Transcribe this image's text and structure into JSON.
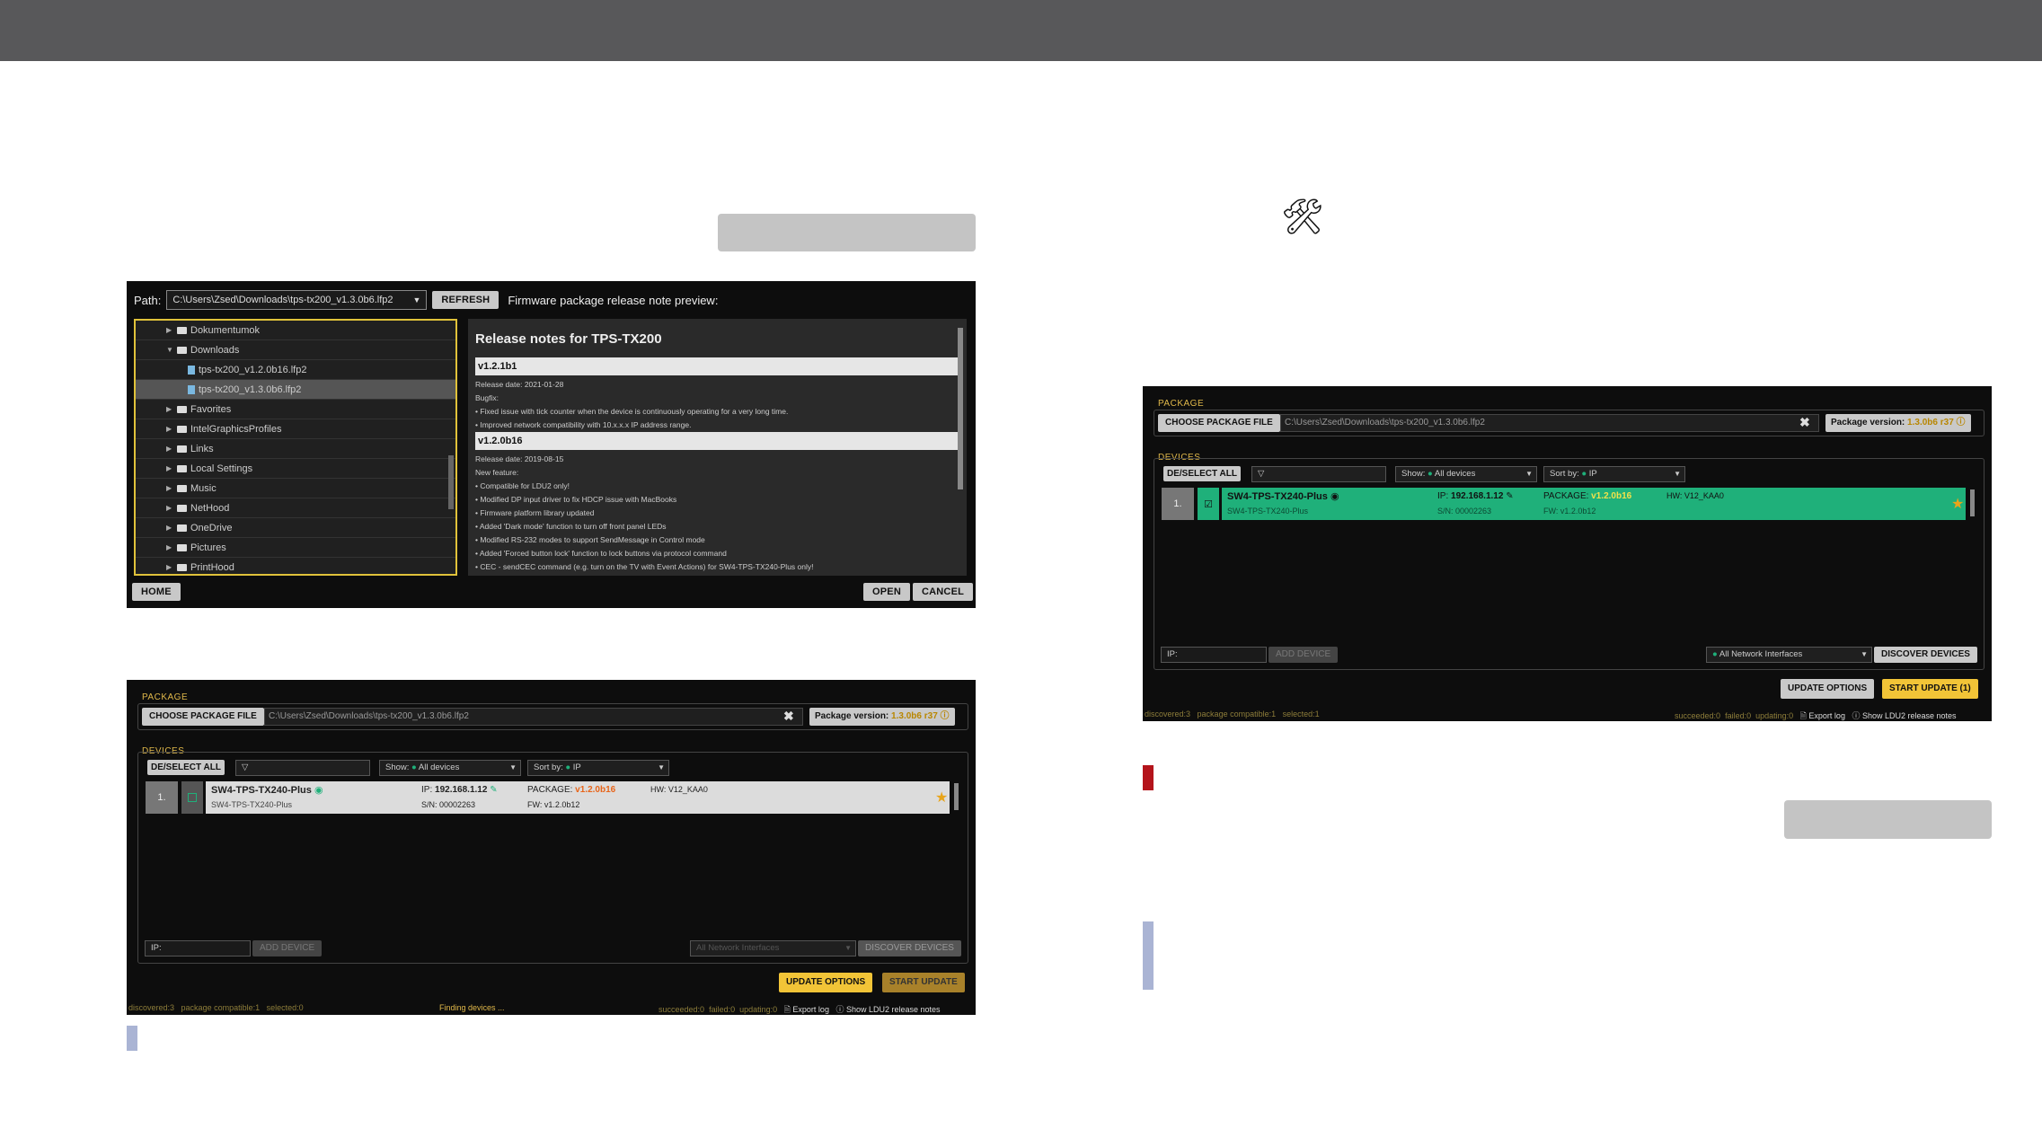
{
  "file_dialog": {
    "path_label": "Path:",
    "path_value": "C:\\Users\\Zsed\\Downloads\\tps-tx200_v1.3.0b6.lfp2",
    "refresh": "REFRESH",
    "preview_label": "Firmware package release note preview:",
    "tree": [
      {
        "label": "Dokumentumok",
        "kind": "folder",
        "indent": 1,
        "expanded": false
      },
      {
        "label": "Downloads",
        "kind": "folder",
        "indent": 1,
        "expanded": true
      },
      {
        "label": "tps-tx200_v1.2.0b16.lfp2",
        "kind": "file",
        "indent": 2
      },
      {
        "label": "tps-tx200_v1.3.0b6.lfp2",
        "kind": "file",
        "indent": 2,
        "selected": true
      },
      {
        "label": "Favorites",
        "kind": "folder",
        "indent": 1
      },
      {
        "label": "IntelGraphicsProfiles",
        "kind": "folder",
        "indent": 1
      },
      {
        "label": "Links",
        "kind": "folder",
        "indent": 1
      },
      {
        "label": "Local Settings",
        "kind": "folder",
        "indent": 1
      },
      {
        "label": "Music",
        "kind": "folder",
        "indent": 1
      },
      {
        "label": "NetHood",
        "kind": "folder",
        "indent": 1
      },
      {
        "label": "OneDrive",
        "kind": "folder",
        "indent": 1
      },
      {
        "label": "Pictures",
        "kind": "folder",
        "indent": 1
      },
      {
        "label": "PrintHood",
        "kind": "folder",
        "indent": 1
      }
    ],
    "notes_title": "Release notes for TPS-TX200",
    "notes": [
      {
        "version": "v1.2.1b1",
        "lines": [
          "Release date: 2021-01-28",
          "Bugfix:",
          "• Fixed issue with tick counter when the device is continuously operating for a very long time.",
          "• Improved network compatibility with 10.x.x.x IP address range."
        ]
      },
      {
        "version": "v1.2.0b16",
        "lines": [
          "Release date: 2019-08-15",
          "New feature:",
          "• Compatible for LDU2 only!",
          "• Modified DP input driver to fix HDCP issue with MacBooks",
          "• Firmware platform library updated",
          "• Added 'Dark mode' function to turn off front panel LEDs",
          "• Modified RS-232 modes to support SendMessage in Control mode",
          "• Added 'Forced button lock' function to lock buttons via protocol command",
          "• CEC - sendCEC command (e.g. turn on the TV with Event Actions) for SW4-TPS-TX240-Plus only!"
        ]
      }
    ],
    "home": "HOME",
    "open": "OPEN",
    "cancel": "CANCEL"
  },
  "panel": {
    "package_label": "PACKAGE",
    "choose_file": "CHOOSE PACKAGE FILE",
    "file_path": "C:\\Users\\Zsed\\Downloads\\tps-tx200_v1.3.0b6.lfp2",
    "package_version_label": "Package version:",
    "package_version": "1.3.0b6 r37",
    "devices_label": "DEVICES",
    "deselect_all": "DE/SELECT ALL",
    "show_label": "Show:",
    "show_value": "All devices",
    "sort_label": "Sort by:",
    "sort_value": "IP",
    "device": {
      "index": "1.",
      "name": "SW4-TPS-TX240-Plus",
      "subname": "SW4-TPS-TX240-Plus",
      "ip_label": "IP:",
      "ip": "192.168.1.12",
      "sn": "S/N: 00002263",
      "package_label": "PACKAGE:",
      "package": "v1.2.0b16",
      "fw": "FW: v1.2.0b12",
      "hw": "HW: V12_KAA0"
    },
    "ip_field": "IP:",
    "add_device": "ADD DEVICE",
    "interfaces": "All Network Interfaces",
    "discover": "DISCOVER DEVICES",
    "update_options": "UPDATE OPTIONS",
    "start_update": "START UPDATE",
    "start_update_selected": "START UPDATE (1)",
    "status": {
      "discovered": "discovered:3",
      "compatible": "package compatible:1",
      "selected": "selected:0",
      "selected_1": "selected:1",
      "finding": "Finding devices ...",
      "succeeded": "succeeded:0",
      "failed": "failed:0",
      "updating": "updating:0",
      "export_log": "Export log",
      "show_notes": "Show LDU2 release notes"
    }
  },
  "colors": {
    "accent_yellow": "#f2c437",
    "selected_green": "#1fb07a",
    "status_red": "#b4141b"
  },
  "icons": {
    "tools": "wrench-screwdriver-icon"
  }
}
